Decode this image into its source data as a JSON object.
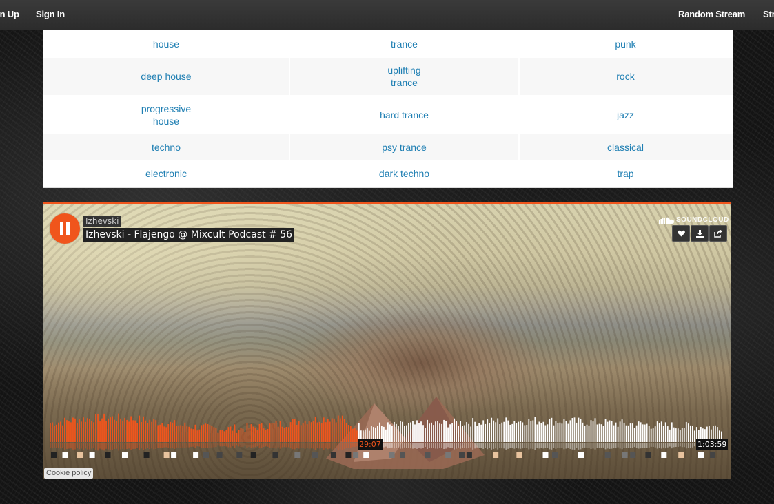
{
  "nav": {
    "signup": "Sign Up",
    "signin": "Sign In",
    "random_stream": "Random Stream",
    "str": "Str"
  },
  "genres": [
    [
      "house",
      "trance",
      "punk"
    ],
    [
      "deep house",
      "uplifting trance",
      "rock"
    ],
    [
      "progressive house",
      "hard trance",
      "jazz"
    ],
    [
      "techno",
      "psy trance",
      "classical"
    ],
    [
      "electronic",
      "dark techno",
      "trap"
    ]
  ],
  "player": {
    "artist": "Izhevski",
    "title": "Izhevski - Flajengo @ Mixcult Podcast # 56",
    "brand": "SOUNDCLOUD",
    "current_time": "29:07",
    "duration": "1:03:59",
    "progress": 0.457,
    "state": "playing",
    "accent_color": "#f0551c",
    "actions": [
      "heart-icon",
      "download-icon",
      "share-icon"
    ],
    "cookie_policy": "Cookie policy"
  }
}
